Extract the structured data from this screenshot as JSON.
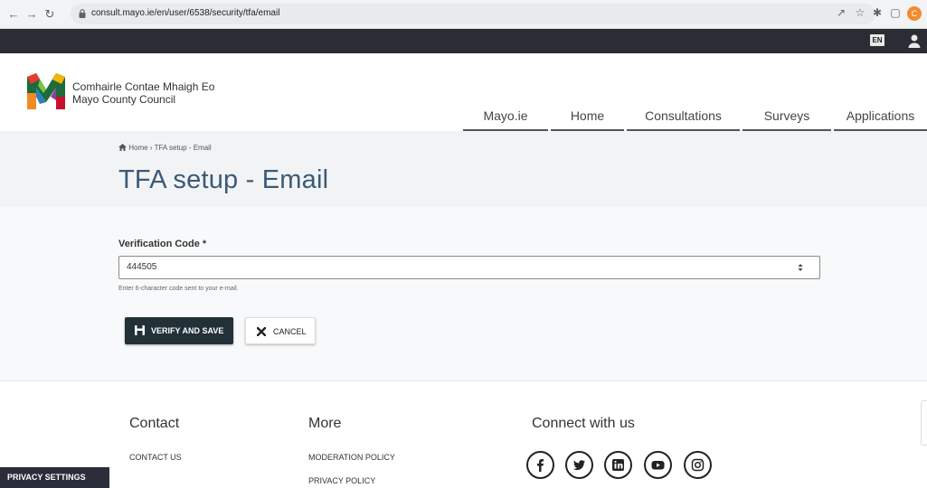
{
  "browser": {
    "url": "consult.mayo.ie/en/user/6538/security/tfa/email",
    "profile_initial": "C"
  },
  "topbar": {
    "language": "EN"
  },
  "header": {
    "org_line1": "Comhairle Contae Mhaigh Eo",
    "org_line2": "Mayo County Council",
    "nav": [
      "Mayo.ie",
      "Home",
      "Consultations",
      "Surveys",
      "Applications"
    ]
  },
  "breadcrumb": {
    "home": "Home",
    "separator": "›",
    "current": "TFA setup - Email"
  },
  "page": {
    "title": "TFA setup - Email"
  },
  "form": {
    "label": "Verification Code",
    "required_mark": "*",
    "value": "444505",
    "help": "Enter 6-character code sent to your e-mail.",
    "save_label": "VERIFY AND SAVE",
    "cancel_label": "CANCEL"
  },
  "footer": {
    "contact_heading": "Contact",
    "contact_link": "CONTACT US",
    "more_heading": "More",
    "moderation_link": "MODERATION POLICY",
    "privacy_link": "PRIVACY POLICY",
    "connect_heading": "Connect with us",
    "social": [
      "facebook-icon",
      "twitter-icon",
      "linkedin-icon",
      "youtube-icon",
      "instagram-icon"
    ]
  },
  "privacy_settings": "PRIVACY SETTINGS",
  "colors": {
    "title": "#3a5a78",
    "dark_bar": "#2a2d34",
    "save_button": "#223038"
  }
}
